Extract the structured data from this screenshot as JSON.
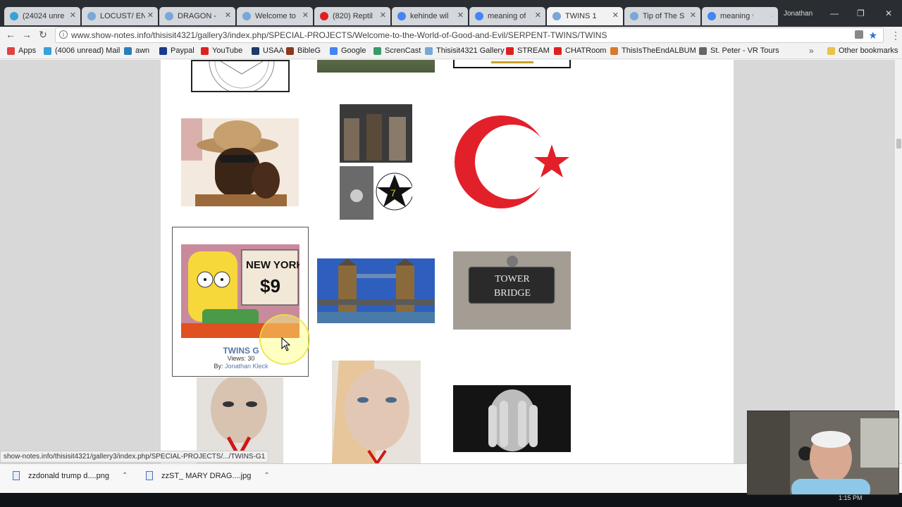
{
  "browser": {
    "tabs": [
      {
        "label": "(24024 unre",
        "active": false,
        "icon": "mail-icon"
      },
      {
        "label": "LOCUST/ EN",
        "active": false,
        "icon": "gallery-icon"
      },
      {
        "label": "DRAGON -",
        "active": false,
        "icon": "gallery-icon"
      },
      {
        "label": "Welcome to",
        "active": false,
        "icon": "gallery-icon"
      },
      {
        "label": "(820) Reptil",
        "active": false,
        "icon": "youtube-icon"
      },
      {
        "label": "kehinde wil",
        "active": false,
        "icon": "google-icon"
      },
      {
        "label": "meaning of",
        "active": false,
        "icon": "google-icon"
      },
      {
        "label": "TWINS 1",
        "active": true,
        "icon": "gallery-icon"
      },
      {
        "label": "Tip of The S",
        "active": false,
        "icon": "gallery-icon"
      },
      {
        "label": "meaning of",
        "active": false,
        "icon": "google-icon"
      }
    ],
    "profile_name": "Jonathan",
    "url": "www.show-notes.info/thisisit4321/gallery3/index.php/SPECIAL-PROJECTS/Welcome-to-the-World-of-Good-and-Evil/SERPENT-TWINS/TWINS",
    "bookmarks": [
      {
        "label": "Apps",
        "icon": "apps-icon",
        "color": "#d44"
      },
      {
        "label": "(4006 unread) Mail",
        "icon": "mail-icon",
        "color": "#3aa0d8"
      },
      {
        "label": "awn",
        "icon": "globe-icon",
        "color": "#2c7fb8"
      },
      {
        "label": "Paypal",
        "icon": "paypal-icon",
        "color": "#1a3a8a"
      },
      {
        "label": "YouTube",
        "icon": "youtube-icon",
        "color": "#e02020"
      },
      {
        "label": "USAA",
        "icon": "usaa-icon",
        "color": "#1c3a6a"
      },
      {
        "label": "BibleG",
        "icon": "bible-icon",
        "color": "#8b3a1a"
      },
      {
        "label": "Google",
        "icon": "google-icon",
        "color": "#4285f4"
      },
      {
        "label": "ScrenCast",
        "icon": "screencast-icon",
        "color": "#3a9a6a"
      },
      {
        "label": "Thisisit4321 Gallery",
        "icon": "gallery-icon",
        "color": "#7aa6d8"
      },
      {
        "label": "STREAM",
        "icon": "youtube-icon",
        "color": "#e02020"
      },
      {
        "label": "CHATRoom",
        "icon": "youtube-icon",
        "color": "#e02020"
      },
      {
        "label": "ThisIsTheEndALBUM",
        "icon": "album-icon",
        "color": "#d87a2a"
      },
      {
        "label": "St. Peter - VR Tours",
        "icon": "tours-icon",
        "color": "#666"
      }
    ],
    "other_bookmarks": "Other bookmarks"
  },
  "gallery": {
    "card": {
      "title": "TWINS G",
      "views": "Views: 30",
      "by_prefix": "By:",
      "author": "Jonathan Kleck"
    },
    "thumbnails": [
      "pentagram-seal-image",
      "green-photo-image",
      "framed-sign-image",
      "man-in-hat-image",
      "photo-collage-image",
      "crescent-star-flag-image",
      "bart-new-york-9-image",
      "tower-bridge-photo-image",
      "tower-bridge-sign-image",
      "v-poster-woman-image",
      "v-poster-split-face-image",
      "hands-over-face-image"
    ],
    "bart_sign_text": "NEW YORK",
    "bart_price_text": "$9",
    "tower_sign_line1": "TOWER",
    "tower_sign_line2": "BRIDGE"
  },
  "statusbar": {
    "link_url": "show-notes.info/thisisit4321/gallery3/index.php/SPECIAL-PROJECTS/.../TWINS-G1"
  },
  "downloads": [
    {
      "name": "zzdonald trump d....png"
    },
    {
      "name": "zzST_ MARY DRAG....jpg"
    }
  ],
  "taskbar": {
    "time": "1:15 PM"
  },
  "colors": {
    "link": "#5577aa",
    "crescent_red": "#e2202a"
  }
}
